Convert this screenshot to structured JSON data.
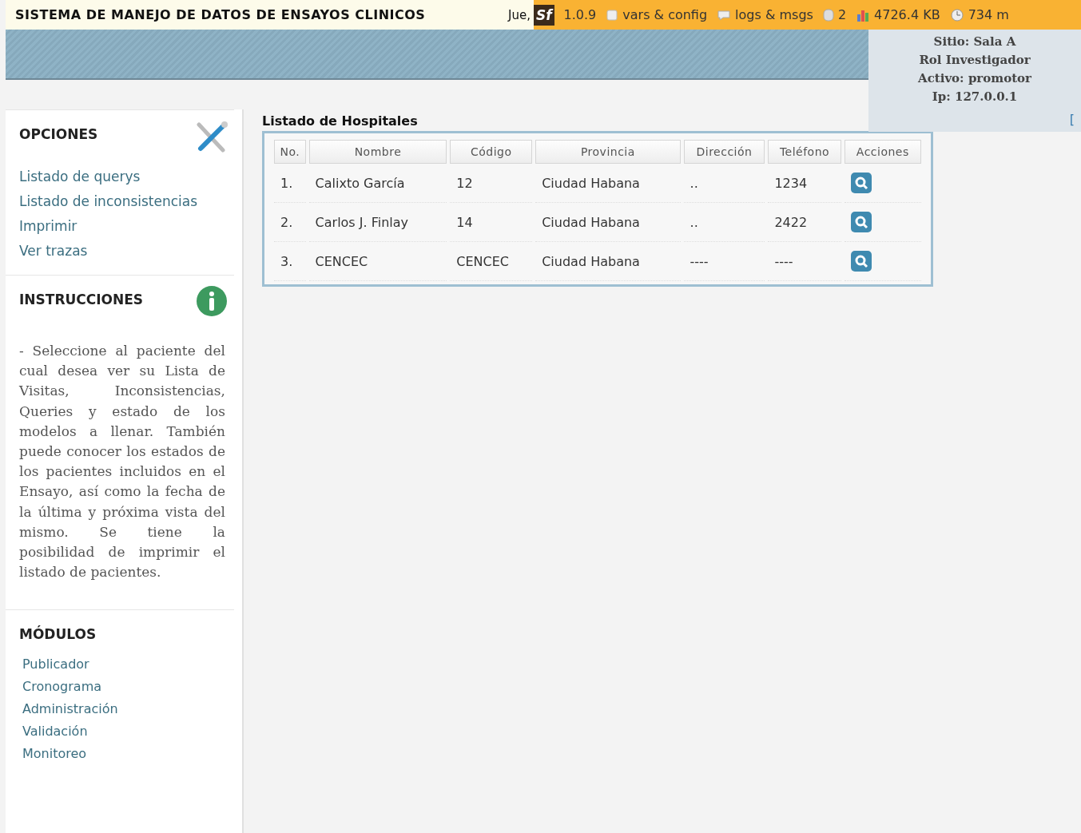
{
  "header": {
    "title": "SISTEMA DE MANEJO DE DATOS DE ENSAYOS CLINICOS",
    "date_prefix": "Jue,"
  },
  "debug_toolbar": {
    "logo": "Sf",
    "version": "1.0.9",
    "items": [
      {
        "kind": "config",
        "label": "vars & config"
      },
      {
        "kind": "logs",
        "label": "logs & msgs"
      },
      {
        "kind": "db",
        "label": "2"
      },
      {
        "kind": "memory",
        "label": "4726.4 KB"
      },
      {
        "kind": "time",
        "label": "734 m"
      }
    ]
  },
  "user_info": [
    {
      "label": "Sitio:",
      "value": "Sala A"
    },
    {
      "label": "Rol",
      "value": "Investigador"
    },
    {
      "label": "Activo:",
      "value": "promotor"
    },
    {
      "label": "Ip:",
      "value": "127.0.0.1"
    }
  ],
  "user_info_extra": "[",
  "sidebar": {
    "sections": [
      {
        "kind": "options",
        "title": "OPCIONES",
        "links": [
          "Listado de querys",
          "Listado de inconsistencias",
          "Imprimir",
          "Ver trazas"
        ]
      },
      {
        "kind": "info",
        "title": "INSTRUCCIONES",
        "text": "- Seleccione al paciente del cual desea ver su Lista de Visitas, Inconsistencias, Queries y estado de los modelos a llenar. También puede conocer los estados de los pacientes incluidos en el Ensayo, así como la fecha de la última y próxima vista del mismo. Se tiene la posibilidad de imprimir el listado de pacientes."
      },
      {
        "kind": "modules",
        "title": "MÓDULOS",
        "links": [
          "Publicador",
          "Cronograma",
          "Administración",
          "Validación",
          "Monitoreo"
        ]
      }
    ]
  },
  "content": {
    "title": "Listado de Hospitales",
    "table": {
      "columns": [
        "No.",
        "Nombre",
        "Código",
        "Provincia",
        "Dirección",
        "Teléfono",
        "Acciones"
      ],
      "rows": [
        [
          "1.",
          "Calixto García",
          "12",
          "Ciudad Habana",
          "..",
          "1234"
        ],
        [
          "2.",
          "Carlos J. Finlay",
          "14",
          "Ciudad Habana",
          "..",
          "2422"
        ],
        [
          "3.",
          "CENCEC",
          "CENCEC",
          "Ciudad Habana",
          "----",
          "----"
        ]
      ]
    }
  }
}
